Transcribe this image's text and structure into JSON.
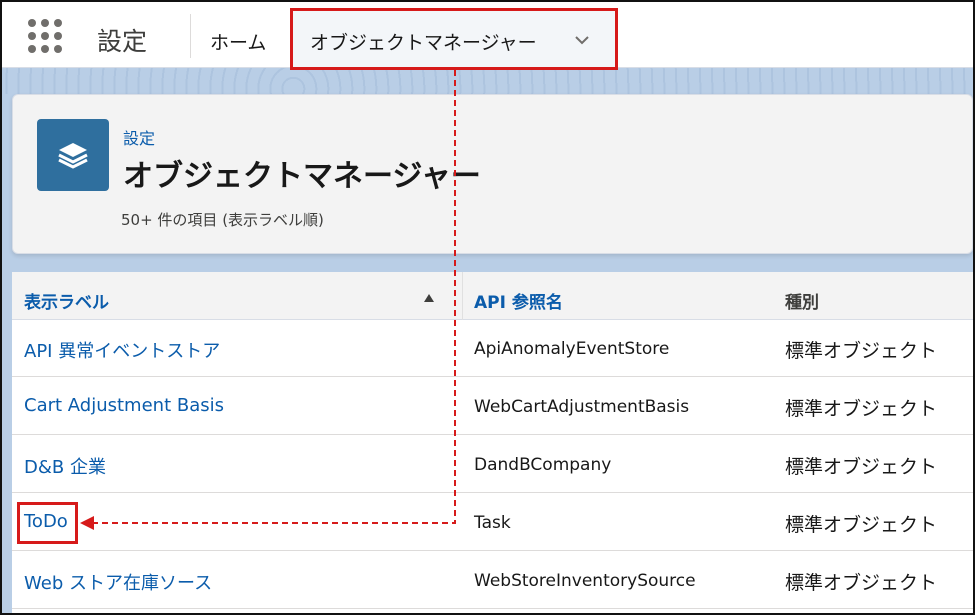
{
  "topnav": {
    "app_title": "設定",
    "home_label": "ホーム",
    "active_tab_label": "オブジェクトマネージャー"
  },
  "header": {
    "breadcrumb": "設定",
    "title": "オブジェクトマネージャー",
    "item_count": "50+ 件の項目 (表示ラベル順)"
  },
  "table": {
    "columns": {
      "label": "表示ラベル",
      "api": "API 参照名",
      "type": "種別"
    },
    "rows": [
      {
        "label": "API 異常イベントストア",
        "api": "ApiAnomalyEventStore",
        "type": "標準オブジェクト"
      },
      {
        "label": "Cart Adjustment Basis",
        "api": "WebCartAdjustmentBasis",
        "type": "標準オブジェクト"
      },
      {
        "label": "D&B 企業",
        "api": "DandBCompany",
        "type": "標準オブジェクト"
      },
      {
        "label": "ToDo",
        "api": "Task",
        "type": "標準オブジェクト"
      },
      {
        "label": "Web ストア在庫ソース",
        "api": "WebStoreInventorySource",
        "type": "標準オブジェクト"
      }
    ]
  },
  "icons": {
    "app_launcher": "app-launcher-grid-icon",
    "tab_menu": "chevron-down-icon",
    "object_manager": "layers-icon",
    "sort": "sort-ascending-icon"
  },
  "colors": {
    "link": "#0b5cab",
    "highlight": "#d61a1a",
    "icon_bg": "#2f6f9e"
  }
}
